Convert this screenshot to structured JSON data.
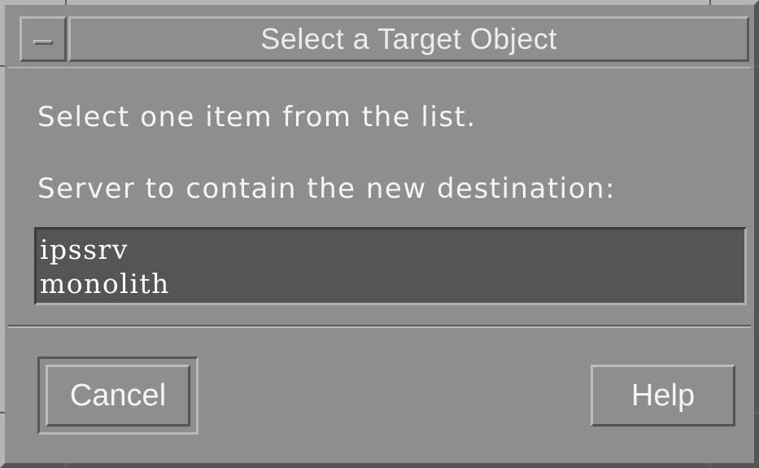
{
  "window": {
    "title": "Select a Target Object",
    "menu_icon": "window-menu-icon"
  },
  "dialog": {
    "instruction": "Select one item from the list.",
    "list_label": "Server to contain the new destination:",
    "items": [
      {
        "label": "ipssrv"
      },
      {
        "label": "monolith"
      }
    ]
  },
  "buttons": {
    "cancel_label": "Cancel",
    "help_label": "Help"
  },
  "colors": {
    "background": "#8e8e8e",
    "list_background": "#555555",
    "text": "#f4f4f4"
  }
}
